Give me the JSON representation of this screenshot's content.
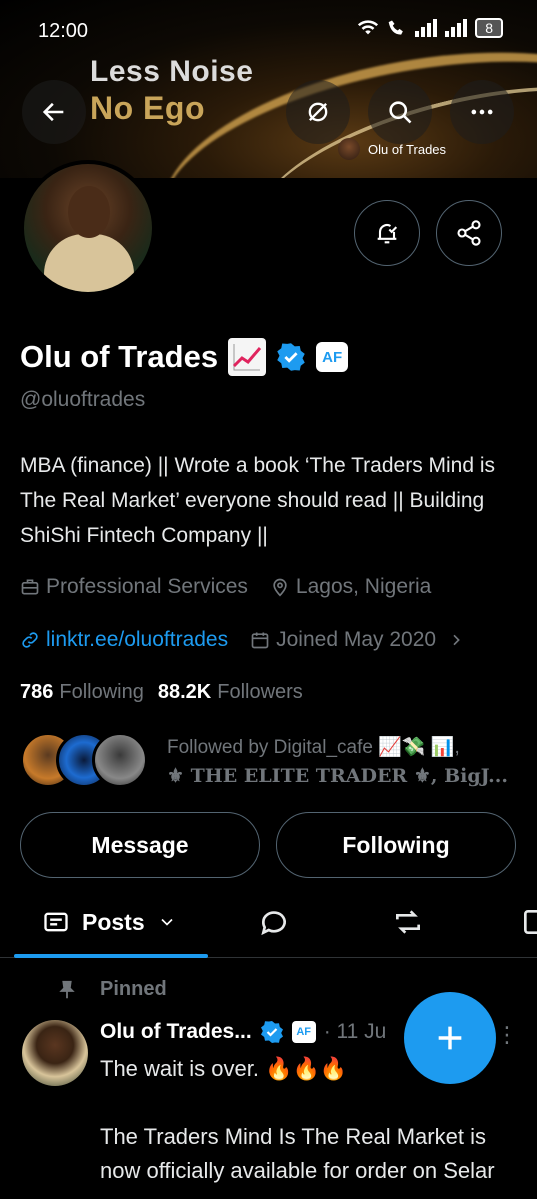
{
  "status_bar": {
    "time": "12:00",
    "battery": "8"
  },
  "banner": {
    "line1": "Less Noise",
    "line2": "No Ego"
  },
  "header": {
    "mini_name": "Olu of Trades"
  },
  "profile": {
    "name": "Olu of Trades",
    "af_badge": "AF",
    "handle": "@oluoftrades",
    "bio": "MBA (finance) || Wrote a book ‘The Traders Mind is The Real Market’ everyone should read || Building ShiShi Fintech Company ||",
    "category": "Professional Services",
    "location": "Lagos, Nigeria",
    "link": "linktr.ee/oluoftrades",
    "joined": "Joined May 2020",
    "following_count": "786",
    "following_label": "Following",
    "followers_count": "88.2K",
    "followers_label": "Followers",
    "followed_by_line1": "Followed by Digital_cafe 📈💸 📊,",
    "followed_by_line2": "⚜ THE ELITE TRADER ⚜, BigJ..."
  },
  "actions": {
    "message": "Message",
    "following": "Following"
  },
  "tabs": {
    "posts": "Posts"
  },
  "pinned_post": {
    "pinned_label": "Pinned",
    "author": "Olu of Trades...",
    "af_badge": "AF",
    "date": "· 11 Ju",
    "text_line1": "The wait is over. 🔥🔥🔥",
    "text_line2": "The Traders Mind Is The Real Market is now officially available for order on Selar"
  },
  "colors": {
    "accent": "#1d9bf0",
    "muted": "#71767b",
    "background": "#000000"
  }
}
